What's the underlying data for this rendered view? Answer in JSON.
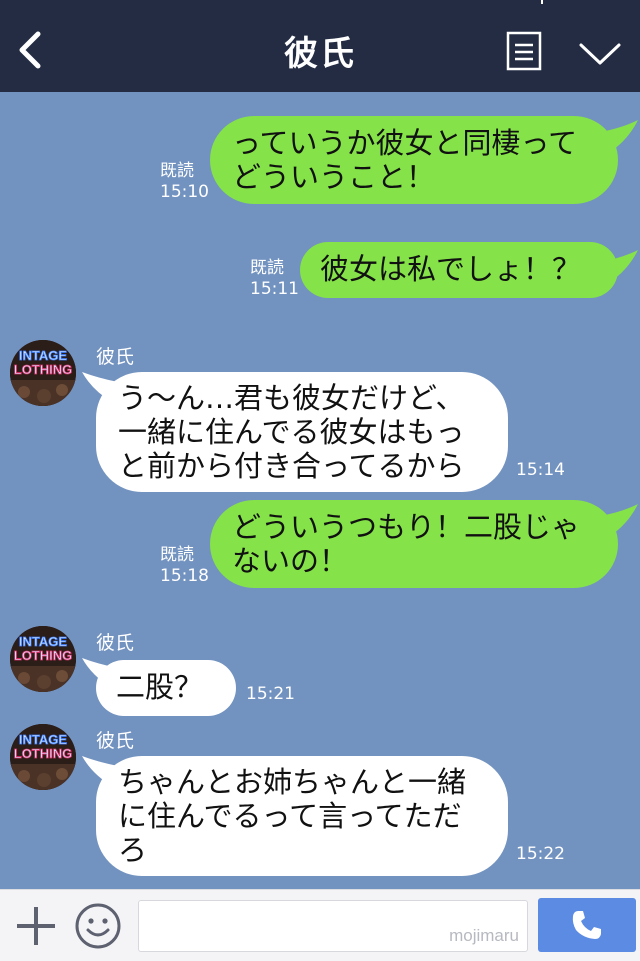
{
  "header": {
    "title": "彼氏",
    "back_icon": "back-chevron-icon",
    "menu_icon": "memo-menu-icon",
    "dropdown_icon": "chevron-down-icon",
    "background": "#232c43"
  },
  "chat": {
    "background": "#7292c0",
    "outgoing_bubble_color": "#85e249",
    "incoming_bubble_color": "#ffffff",
    "messages": [
      {
        "direction": "out",
        "lines": [
          "っていうか彼女と同棲って",
          "どういうこと！"
        ],
        "read": "既読",
        "time": "15:10"
      },
      {
        "direction": "out",
        "lines": [
          "彼女は私でしょ！？"
        ],
        "read": "既読",
        "time": "15:11"
      },
      {
        "direction": "in",
        "sender": "彼氏",
        "lines": [
          "う〜ん…君も彼女だけど、",
          "一緒に住んでる彼女はもっ",
          "と前から付き合ってるから"
        ],
        "time": "15:14"
      },
      {
        "direction": "out",
        "lines": [
          "どういうつもり！二股じゃ",
          "ないの！"
        ],
        "read": "既読",
        "time": "15:18"
      },
      {
        "direction": "in",
        "sender": "彼氏",
        "lines": [
          "二股？"
        ],
        "time": "15:21"
      },
      {
        "direction": "in",
        "sender": "彼氏",
        "lines": [
          "ちゃんとお姉ちゃんと一緒",
          "に住んでるって言ってただ",
          "ろ"
        ],
        "time": "15:22"
      }
    ],
    "avatar_text": [
      "INTAGE",
      "LOTHING"
    ]
  },
  "input_bar": {
    "plus_icon": "plus-icon",
    "emoji_icon": "smiley-icon",
    "input_value": "",
    "watermark": "mojimaru",
    "call_icon": "phone-icon",
    "call_button_color": "#5b8be3"
  }
}
